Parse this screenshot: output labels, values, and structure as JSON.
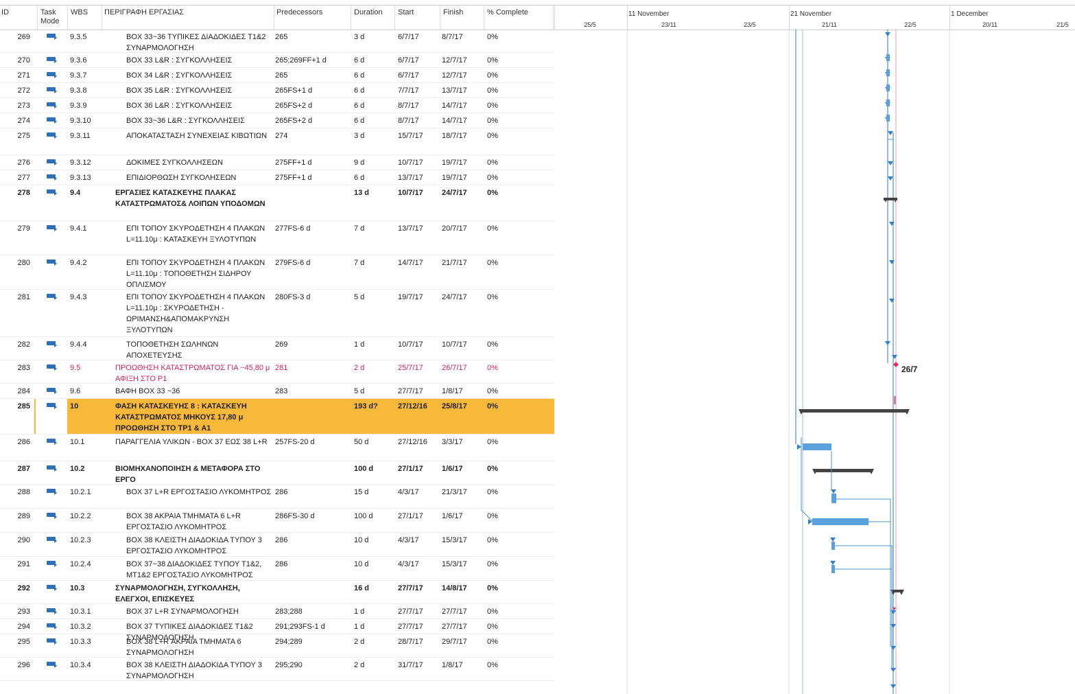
{
  "columns": {
    "id": "ID",
    "mode": "Task Mode",
    "wbs": "WBS",
    "name": "ΠΕΡΙΓΡΑΦΗ ΕΡΓΑΣΙΑΣ",
    "pred": "Predecessors",
    "dur": "Duration",
    "start": "Start",
    "finish": "Finish",
    "pct": "% Complete"
  },
  "timescale": {
    "top": [
      "11 November",
      "21 November",
      "1 December"
    ],
    "bottom": [
      "25/5",
      "23/11",
      "23/5",
      "21/11",
      "22/5",
      "20/11",
      "21/5"
    ]
  },
  "colors": {
    "task_blue": "#5aa0dc",
    "summary_dark": "#444444",
    "critical": "#d3235a",
    "highlight": "#f8b83a",
    "link": "#4a90d0",
    "status_line": "#e89aa8"
  },
  "rows": [
    {
      "id": "269",
      "wbs": "9.3.5",
      "name": "ΒΟΧ 33~36 ΤΥΠΙΚΕΣ ΔΙΑΔΟΚΙΔΕΣ Τ1&2 ΣΥΝΑΡΜΟΛΟΓΗΣΗ",
      "pred": "265",
      "dur": "3 d",
      "start": "6/7/17",
      "finish": "8/7/17",
      "pct": "0%",
      "indent": true,
      "style": "normal"
    },
    {
      "id": "270",
      "wbs": "9.3.6",
      "name": "ΒΟΧ 33 L&R : ΣΥΓΚΟΛΛΗΣΕΙΣ",
      "pred": "265;269FF+1 d",
      "dur": "6 d",
      "start": "6/7/17",
      "finish": "12/7/17",
      "pct": "0%",
      "indent": true,
      "style": "normal"
    },
    {
      "id": "271",
      "wbs": "9.3.7",
      "name": "ΒΟΧ 34 L&R : ΣΥΓΚΟΛΛΗΣΕΙΣ",
      "pred": "265",
      "dur": "6 d",
      "start": "6/7/17",
      "finish": "12/7/17",
      "pct": "0%",
      "indent": true,
      "style": "normal"
    },
    {
      "id": "272",
      "wbs": "9.3.8",
      "name": "ΒΟΧ 35 L&R : ΣΥΓΚΟΛΛΗΣΕΙΣ",
      "pred": "265FS+1 d",
      "dur": "6 d",
      "start": "7/7/17",
      "finish": "13/7/17",
      "pct": "0%",
      "indent": true,
      "style": "normal"
    },
    {
      "id": "273",
      "wbs": "9.3.9",
      "name": "ΒΟΧ 36 L&R : ΣΥΓΚΟΛΛΗΣΕΙΣ",
      "pred": "265FS+2 d",
      "dur": "6 d",
      "start": "8/7/17",
      "finish": "14/7/17",
      "pct": "0%",
      "indent": true,
      "style": "normal"
    },
    {
      "id": "274",
      "wbs": "9.3.10",
      "name": "ΒΟΧ 33~36 L&R : ΣΥΓΚΟΛΛΗΣΕΙΣ",
      "pred": "265FS+2 d",
      "dur": "6 d",
      "start": "8/7/17",
      "finish": "14/7/17",
      "pct": "0%",
      "indent": true,
      "style": "normal"
    },
    {
      "id": "275",
      "wbs": "9.3.11",
      "name": "ΑΠΟΚΑΤΑΣΤΑΣΗ ΣΥΝΕΧΕΙΑΣ ΚΙΒΩΤΙΩΝ",
      "pred": "274",
      "dur": "3 d",
      "start": "15/7/17",
      "finish": "18/7/17",
      "pct": "0%",
      "indent": true,
      "style": "normal"
    },
    {
      "id": "276",
      "wbs": "9.3.12",
      "name": "ΔΟΚΙΜΕΣ ΣΥΓΚΟΛΛΗΣΕΩΝ",
      "pred": "275FF+1 d",
      "dur": "9 d",
      "start": "10/7/17",
      "finish": "19/7/17",
      "pct": "0%",
      "indent": true,
      "style": "normal"
    },
    {
      "id": "277",
      "wbs": "9.3.13",
      "name": "ΕΠΙΔΙΟΡΘΩΣΗ ΣΥΓΚΟΛΗΣΕΩΝ",
      "pred": "275FF+1 d",
      "dur": "6 d",
      "start": "13/7/17",
      "finish": "19/7/17",
      "pct": "0%",
      "indent": true,
      "style": "normal"
    },
    {
      "id": "278",
      "wbs": "9.4",
      "name": "ΕΡΓΑΣΙΕΣ ΚΑΤΑΣΚΕΥΗΣ ΠΛΑΚΑΣ ΚΑΤΑΣΤΡΩΜΑΤΟΣ& ΛΟΙΠΩΝ ΥΠΟΔΟΜΩΝ",
      "pred": "",
      "dur": "13 d",
      "start": "10/7/17",
      "finish": "24/7/17",
      "pct": "0%",
      "indent": false,
      "style": "summary"
    },
    {
      "id": "279",
      "wbs": "9.4.1",
      "name": "ΕΠΙ ΤΟΠΟΥ ΣΚΥΡΟΔΕΤΗΣΗ 4 ΠΛΑΚΩΝ L=11.10μ : ΚΑΤΑΣΚΕΥΗ ΞΥΛΟΤΥΠΩΝ",
      "pred": "277FS-6 d",
      "dur": "7 d",
      "start": "13/7/17",
      "finish": "20/7/17",
      "pct": "0%",
      "indent": true,
      "style": "normal"
    },
    {
      "id": "280",
      "wbs": "9.4.2",
      "name": "ΕΠΙ ΤΟΠΟΥ ΣΚΥΡΟΔΕΤΗΣΗ 4 ΠΛΑΚΩΝ L=11.10μ : ΤΟΠΟΘΕΤΗΣΗ ΣΙΔΗΡΟΥ ΟΠΛΙΣΜΟΥ",
      "pred": "279FS-6 d",
      "dur": "7 d",
      "start": "14/7/17",
      "finish": "21/7/17",
      "pct": "0%",
      "indent": true,
      "style": "normal"
    },
    {
      "id": "281",
      "wbs": "9.4.3",
      "name": "ΕΠΙ ΤΟΠΟΥ ΣΚΥΡΟΔΕΤΗΣΗ 4 ΠΛΑΚΩΝ L=11.10μ : ΣΚΥΡΟΔΕΤΗΣΗ - ΩΡΙΜΑΝΣΗ&ΑΠΟΜΑΚΡΥΝΣΗ ΞΥΛΟΤΥΠΩΝ",
      "pred": "280FS-3 d",
      "dur": "5 d",
      "start": "19/7/17",
      "finish": "24/7/17",
      "pct": "0%",
      "indent": true,
      "style": "normal"
    },
    {
      "id": "282",
      "wbs": "9.4.4",
      "name": "ΤΟΠΟΘΕΤΗΣΗ ΣΩΛΗΝΩΝ ΑΠΟΧΕΤΕΥΣΗΣ",
      "pred": "269",
      "dur": "1 d",
      "start": "10/7/17",
      "finish": "10/7/17",
      "pct": "0%",
      "indent": true,
      "style": "normal"
    },
    {
      "id": "283",
      "wbs": "9.5",
      "name": "ΠΡΟΩΘΗΣΗ ΚΑΤΑΣΤΡΩΜΑΤΟΣ ΓΙΑ ~45,80 μ ΑΦΙΞΗ ΣΤΟ Ρ1",
      "pred": "281",
      "dur": "2 d",
      "start": "25/7/17",
      "finish": "26/7/17",
      "pct": "0%",
      "indent": false,
      "style": "critical"
    },
    {
      "id": "284",
      "wbs": "9.6",
      "name": "ΒΑΦΗ ΒΟΧ 33 ~36",
      "pred": "283",
      "dur": "5 d",
      "start": "27/7/17",
      "finish": "1/8/17",
      "pct": "0%",
      "indent": false,
      "style": "normal"
    },
    {
      "id": "285",
      "wbs": "10",
      "name": "ΦΑΣΗ ΚΑΤΑΣΚΕΥΗΣ 8 : ΚΑΤΑΣΚΕΥΗ ΚΑΤΑΣΤΡΩΜΑΤΟΣ ΜΗΚΟΥΣ 17,80 μ ΠΡΟΩΘΗΣΗ ΣΤΟ ΤΡ1 & Α1",
      "pred": "",
      "dur": "193 d?",
      "start": "27/12/16",
      "finish": "25/8/17",
      "pct": "0%",
      "indent": false,
      "style": "highlight"
    },
    {
      "id": "286",
      "wbs": "10.1",
      "name": "ΠΑΡΑΓΓΕΛΙΑ ΥΛΙΚΩΝ - ΒΟΧ 37 ΕΩΣ 38 L+R",
      "pred": "257FS-20 d",
      "dur": "50 d",
      "start": "27/12/16",
      "finish": "3/3/17",
      "pct": "0%",
      "indent": false,
      "style": "normal"
    },
    {
      "id": "287",
      "wbs": "10.2",
      "name": "ΒΙΟΜΗΧΑΝΟΠΟΙΗΣΗ & ΜΕΤΑΦΟΡΑ ΣΤΟ ΕΡΓΟ",
      "pred": "",
      "dur": "100 d",
      "start": "27/1/17",
      "finish": "1/6/17",
      "pct": "0%",
      "indent": false,
      "style": "summary"
    },
    {
      "id": "288",
      "wbs": "10.2.1",
      "name": "ΒΟΧ 37 L+R ΕΡΓΟΣΤΑΣΙΟ ΛΥΚΟΜΗΤΡΟΣ",
      "pred": "286",
      "dur": "15 d",
      "start": "4/3/17",
      "finish": "21/3/17",
      "pct": "0%",
      "indent": true,
      "style": "normal"
    },
    {
      "id": "289",
      "wbs": "10.2.2",
      "name": "ΒΟΧ 38 ΑΚΡΑΙΑ ΤΜΗΜΑΤΑ 6  L+R ΕΡΓΟΣΤΑΣΙΟ ΛΥΚΟΜΗΤΡΟΣ",
      "pred": "286FS-30 d",
      "dur": "100 d",
      "start": "27/1/17",
      "finish": "1/6/17",
      "pct": "0%",
      "indent": true,
      "style": "normal"
    },
    {
      "id": "290",
      "wbs": "10.2.3",
      "name": "ΒΟΧ 38 ΚΛΕΙΣΤΗ ΔΙΑΔΟΚΙΔΑ ΤΥΠΟΥ 3 ΕΡΓΟΣΤΑΣΙΟ ΛΥΚΟΜΗΤΡΟΣ",
      "pred": "286",
      "dur": "10 d",
      "start": "4/3/17",
      "finish": "15/3/17",
      "pct": "0%",
      "indent": true,
      "style": "normal"
    },
    {
      "id": "291",
      "wbs": "10.2.4",
      "name": "ΒΟΧ 37~38 ΔΙΑΔΟΚΙΔΕΣ ΤΥΠΟΥ Τ1&2, ΜΤ1&2 ΕΡΓΟΣΤΑΣΙΟ ΛΥΚΟΜΗΤΡΟΣ",
      "pred": "286",
      "dur": "10 d",
      "start": "4/3/17",
      "finish": "15/3/17",
      "pct": "0%",
      "indent": true,
      "style": "normal"
    },
    {
      "id": "292",
      "wbs": "10.3",
      "name": "ΣΥΝΑΡΜΟΛΟΓΗΣΗ, ΣΥΓΚΟΛΛΗΣΗ, ΕΛΕΓΧΟΙ, ΕΠΙΣΚΕΥΕΣ",
      "pred": "",
      "dur": "16 d",
      "start": "27/7/17",
      "finish": "14/8/17",
      "pct": "0%",
      "indent": false,
      "style": "summary"
    },
    {
      "id": "293",
      "wbs": "10.3.1",
      "name": "ΒΟΧ 37 L+R ΣΥΝΑΡΜΟΛΟΓΗΣΗ",
      "pred": "283;288",
      "dur": "1 d",
      "start": "27/7/17",
      "finish": "27/7/17",
      "pct": "0%",
      "indent": true,
      "style": "normal"
    },
    {
      "id": "294",
      "wbs": "10.3.2",
      "name": "ΒΟΧ 37 ΤΥΠΙΚΕΣ ΔΙΑΔΟΚΙΔΕΣ Τ1&2 ΣΥΝΑΡΜΟΛΟΓΗΣΗ",
      "pred": "291;293FS-1 d",
      "dur": "1 d",
      "start": "27/7/17",
      "finish": "27/7/17",
      "pct": "0%",
      "indent": true,
      "style": "normal"
    },
    {
      "id": "295",
      "wbs": "10.3.3",
      "name": "ΒΟΧ 38 L+R ΑΚΡΑΙΑ ΤΜΗΜΑΤΑ 6 ΣΥΝΑΡΜΟΛΟΓΗΣΗ",
      "pred": "294;289",
      "dur": "2 d",
      "start": "28/7/17",
      "finish": "29/7/17",
      "pct": "0%",
      "indent": true,
      "style": "normal"
    },
    {
      "id": "296",
      "wbs": "10.3.4",
      "name": "ΒΟΧ 38 ΚΛΕΙΣΤΗ ΔΙΑΔΟΚΙΔΑ ΤΥΠΟΥ 3 ΣΥΝΑΡΜΟΛΟΓΗΣΗ",
      "pred": "295;290",
      "dur": "2 d",
      "start": "31/7/17",
      "finish": "1/8/17",
      "pct": "0%",
      "indent": true,
      "style": "normal"
    }
  ],
  "milestone_label": "26/7"
}
